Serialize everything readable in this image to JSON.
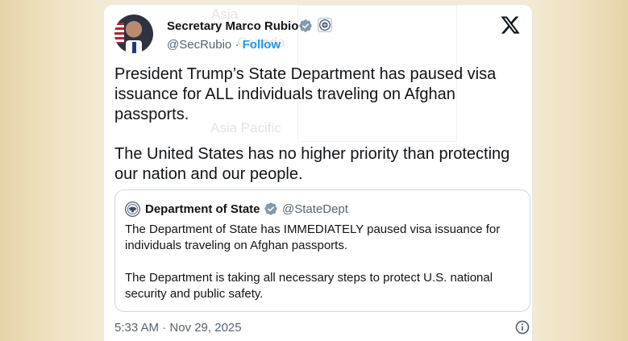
{
  "tweet": {
    "author": {
      "name": "Secretary Marco Rubio",
      "handle": "@SecRubio",
      "separator": " · ",
      "follow_label": "Follow"
    },
    "body": [
      "President Trump’s State Department has paused visa issuance for ALL individuals traveling on Afghan passports.",
      "The United States has no higher priority than protecting our nation and our people."
    ],
    "quoted": {
      "name": "Department of State",
      "handle": "@StateDept",
      "body": [
        "The Department of State has IMMEDIATELY paused visa issuance for individuals traveling on Afghan passports.",
        "The Department is taking all necessary steps to protect U.S. national security and public safety."
      ]
    },
    "timestamp": "5:33 AM · Nov 29, 2025"
  },
  "background_ghost_text": [
    "Asia",
    "Canada",
    "Asia Pacific"
  ],
  "colors": {
    "verified": "#829aab",
    "follow": "#1d9bf0",
    "text": "#0f1419",
    "muted": "#536471"
  },
  "icons": [
    "verified-badge-icon",
    "state-seal-icon",
    "x-logo-icon",
    "info-icon"
  ]
}
